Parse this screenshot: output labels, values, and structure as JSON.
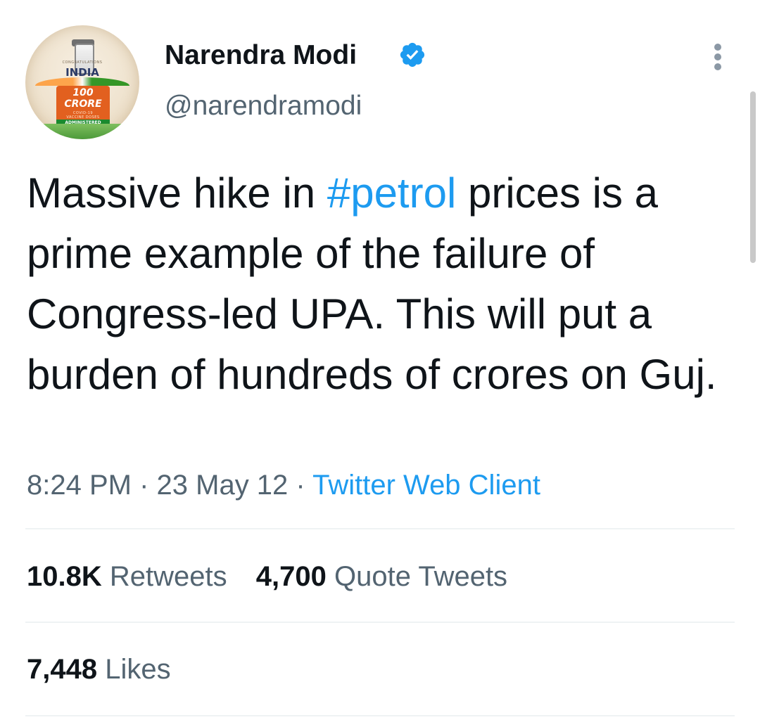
{
  "author": {
    "display_name": "Narendra Modi",
    "handle": "@narendramodi",
    "verified": true,
    "avatar": {
      "congrats_text": "CONGRATULATIONS",
      "country_text": "INDIA",
      "number_text": "100",
      "unit_text": "CRORE",
      "line1_text": "COVID-19",
      "line2_text": "VACCINE DOSES",
      "admin_text": "ADMINISTERED"
    }
  },
  "tweet": {
    "text_before": "Massive hike in ",
    "hashtag": "#petrol",
    "text_after": " prices is a prime example of the failure of Congress-led UPA. This will put a burden of hundreds of crores on Guj."
  },
  "meta": {
    "time": "8:24 PM",
    "separator": " · ",
    "date": "23 May 12",
    "source": "Twitter Web Client"
  },
  "stats": {
    "retweets_count": "10.8K",
    "retweets_label": "Retweets",
    "quotes_count": "4,700",
    "quotes_label": "Quote Tweets",
    "likes_count": "7,448",
    "likes_label": "Likes"
  },
  "icons": {
    "verified": "verified-badge-icon",
    "more": "more-options-icon"
  },
  "colors": {
    "accent": "#1d9bf0",
    "text_primary": "#0f1419",
    "text_secondary": "#536471",
    "divider": "#eff3f4"
  }
}
